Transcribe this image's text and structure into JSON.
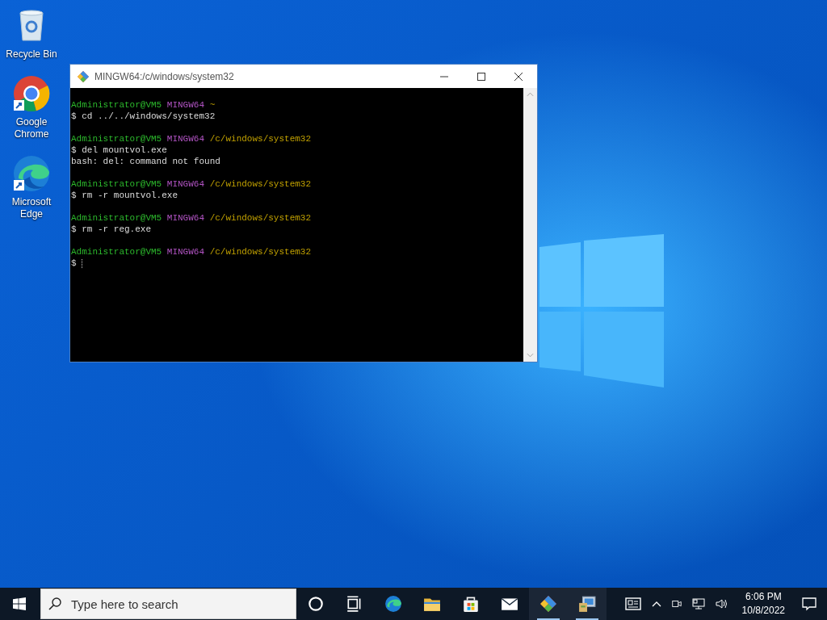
{
  "desktop_icons": [
    {
      "kind": "recycle",
      "label": "Recycle Bin",
      "shortcut": false
    },
    {
      "kind": "chrome",
      "label": "Google Chrome",
      "shortcut": true
    },
    {
      "kind": "edge",
      "label": "Microsoft Edge",
      "shortcut": true
    }
  ],
  "window": {
    "title": "MINGW64:/c/windows/system32",
    "terminal": {
      "cursor": true,
      "blocks": [
        {
          "prompt": {
            "user": "Administrator@VM5",
            "host": "MINGW64",
            "path": "~"
          },
          "lines": [
            "$ cd ../../windows/system32"
          ]
        },
        {
          "prompt": {
            "user": "Administrator@VM5",
            "host": "MINGW64",
            "path": "/c/windows/system32"
          },
          "lines": [
            "$ del mountvol.exe",
            "bash: del: command not found"
          ]
        },
        {
          "prompt": {
            "user": "Administrator@VM5",
            "host": "MINGW64",
            "path": "/c/windows/system32"
          },
          "lines": [
            "$ rm -r mountvol.exe"
          ]
        },
        {
          "prompt": {
            "user": "Administrator@VM5",
            "host": "MINGW64",
            "path": "/c/windows/system32"
          },
          "lines": [
            "$ rm -r reg.exe"
          ]
        },
        {
          "prompt": {
            "user": "Administrator@VM5",
            "host": "MINGW64",
            "path": "/c/windows/system32"
          },
          "lines": [
            "$"
          ]
        }
      ]
    }
  },
  "taskbar": {
    "search": {
      "placeholder": "Type here to search"
    },
    "apps": [
      {
        "kind": "cortana",
        "running": false
      },
      {
        "kind": "taskview",
        "running": false
      },
      {
        "kind": "edge",
        "running": false
      },
      {
        "kind": "folder",
        "running": false
      },
      {
        "kind": "store",
        "running": false
      },
      {
        "kind": "mail",
        "running": false
      },
      {
        "kind": "git",
        "running": true
      },
      {
        "kind": "setup",
        "running": true
      }
    ],
    "clock": {
      "time": "6:06 PM",
      "date": "10/8/2022"
    }
  }
}
